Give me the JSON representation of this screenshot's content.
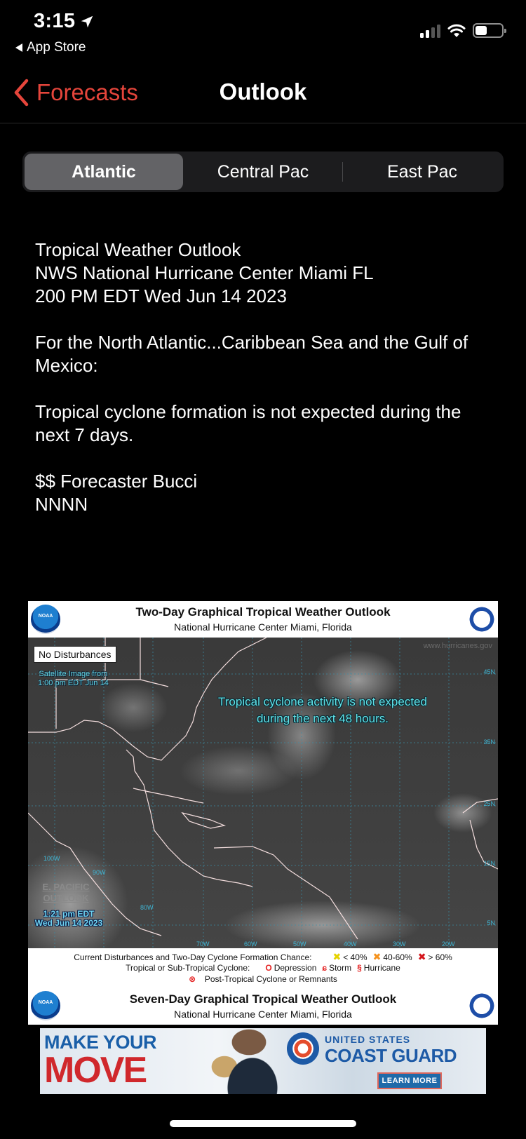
{
  "status_bar": {
    "time": "3:15",
    "location_icon": "location-arrow-icon",
    "back_app": "App Store",
    "signal_bars": 2,
    "signal_total": 4,
    "wifi_icon": "wifi-icon",
    "battery_level": 0.45
  },
  "nav": {
    "back_label": "Forecasts",
    "title": "Outlook"
  },
  "segments": [
    {
      "label": "Atlantic",
      "active": true
    },
    {
      "label": "Central Pac",
      "active": false
    },
    {
      "label": "East Pac",
      "active": false
    }
  ],
  "outlook": {
    "line1": "Tropical Weather Outlook",
    "line2": "NWS National Hurricane Center Miami FL",
    "line3": "200 PM EDT Wed Jun 14 2023",
    "para1": "For the North Atlantic...Caribbean Sea and the Gulf of Mexico:",
    "para2": "Tropical cyclone formation is not expected during the next 7 days.",
    "sig1": "$$ Forecaster Bucci",
    "sig2": "NNNN"
  },
  "graphic": {
    "title": "Two-Day Graphical Tropical Weather Outlook",
    "subtitle": "National Hurricane Center  Miami, Florida",
    "noaa_label": "NOAA",
    "no_disturbances": "No Disturbances",
    "satellite_note_1": "Satellite Image from",
    "satellite_note_2": "1:00 pm EDT Jun 14",
    "activity_line1": "Tropical cyclone activity is not expected",
    "activity_line2": "during the next 48 hours.",
    "watermark": "www.hurricanes.gov",
    "epac_line1": "E. PACIFIC",
    "epac_line2": "OUTLOOK",
    "epac_time1": "1:21 pm EDT",
    "epac_time2": "Wed Jun 14 2023",
    "lat_labels": [
      "45N",
      "35N",
      "25N",
      "15N",
      "5N"
    ],
    "lon_labels": [
      "100W",
      "90W",
      "80W",
      "70W",
      "60W",
      "50W",
      "40W",
      "30W",
      "20W"
    ],
    "legend": {
      "row1_label": "Current Disturbances and Two-Day Cyclone Formation Chance:",
      "low": "< 40%",
      "mid": "40-60%",
      "high": "> 60%",
      "low_color": "#f2e600",
      "mid_color": "#f5931e",
      "high_color": "#d4151c",
      "row2_label": "Tropical or Sub-Tropical Cyclone:",
      "depression": "Depression",
      "storm": "Storm",
      "hurricane": "Hurricane",
      "row3_label": "Post-Tropical Cyclone or Remnants"
    },
    "footer_title": "Seven-Day Graphical Tropical Weather Outlook",
    "footer_subtitle": "National Hurricane Center  Miami, Florida"
  },
  "ad": {
    "headline1": "MAKE YOUR",
    "headline2": "MOVE",
    "brand_line1": "UNITED STATES",
    "brand_line2": "COAST GUARD",
    "cta": "LEARN MORE"
  }
}
